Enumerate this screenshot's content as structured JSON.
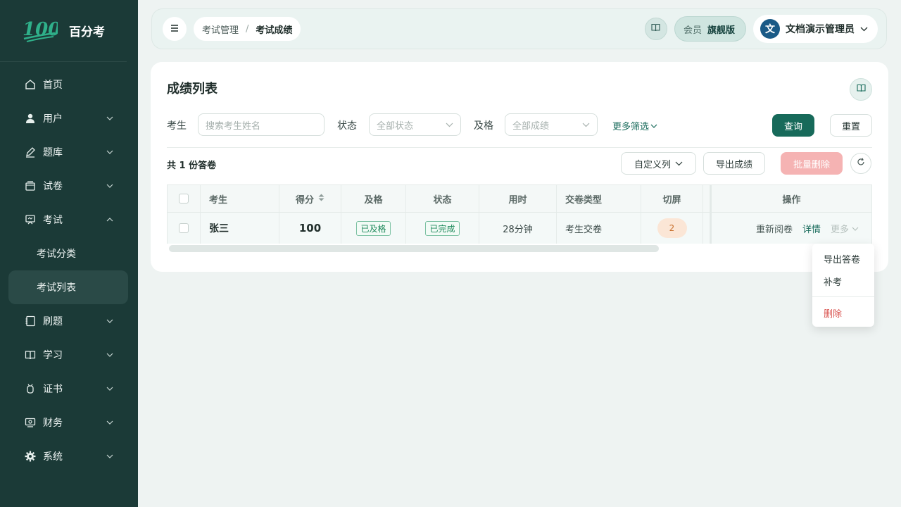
{
  "brand": {
    "logo_text": "100",
    "name": "百分考"
  },
  "sidebar": {
    "items": [
      {
        "label": "首页"
      },
      {
        "label": "用户"
      },
      {
        "label": "题库"
      },
      {
        "label": "试卷"
      },
      {
        "label": "考试"
      },
      {
        "label": "刷题"
      },
      {
        "label": "学习"
      },
      {
        "label": "证书"
      },
      {
        "label": "财务"
      },
      {
        "label": "系统"
      }
    ],
    "exam_sub": [
      {
        "label": "考试分类"
      },
      {
        "label": "考试列表"
      }
    ]
  },
  "header": {
    "breadcrumb": [
      "考试管理",
      "考试成绩"
    ],
    "breadcrumb_sep": "/",
    "vip_label": "会员",
    "vip_value": "旗舰版",
    "avatar_text": "文",
    "user_name": "文档演示管理员"
  },
  "card": {
    "title": "成绩列表",
    "filters": {
      "examinee_label": "考生",
      "examinee_placeholder": "搜索考生姓名",
      "status_label": "状态",
      "status_value": "全部状态",
      "pass_label": "及格",
      "pass_value": "全部成绩",
      "more": "更多筛选"
    },
    "buttons": {
      "query": "查询",
      "reset": "重置",
      "custom_columns": "自定义列",
      "export_scores": "导出成绩",
      "batch_delete": "批量删除"
    },
    "total_text": "共 1 份答卷"
  },
  "table": {
    "columns": [
      "考生",
      "得分",
      "及格",
      "状态",
      "用时",
      "交卷类型",
      "切屏",
      "操作"
    ],
    "rows": [
      {
        "name": "张三",
        "score": "100",
        "pass": "已及格",
        "status": "已完成",
        "duration": "28分钟",
        "submit_type": "考生交卷",
        "switch_count": "2",
        "actions": {
          "regrade": "重新阅卷",
          "detail": "详情",
          "more": "更多"
        }
      }
    ]
  },
  "more_menu": {
    "items": [
      "导出答卷",
      "补考",
      "删除"
    ]
  },
  "colors": {
    "sidebar_bg": "#1b3a37",
    "primary": "#176a5a",
    "danger": "#d9534f"
  }
}
